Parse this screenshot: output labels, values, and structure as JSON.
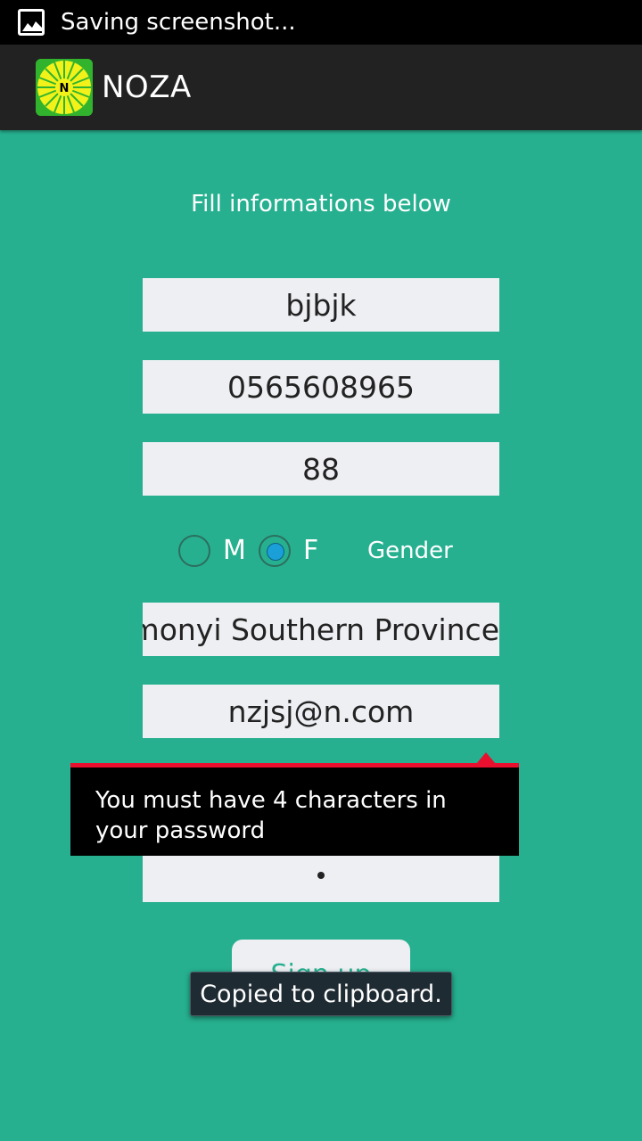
{
  "status_bar": {
    "notification_icon": "image-icon",
    "text": "Saving screenshot..."
  },
  "action_bar": {
    "logo_icon": "noza-logo",
    "logo_letter": "N",
    "title": "NOZA"
  },
  "form": {
    "instruction": "Fill informations below",
    "name_value": "bjbjk",
    "phone_value": "0565608965",
    "age_value": "88",
    "gender": {
      "option_m": "M",
      "option_f": "F",
      "label": "Gender",
      "selected": "F"
    },
    "address_value": "monyi Southern Province",
    "email_value": "nzjsj@n.com",
    "password_masked": "•",
    "signup_label": "Sign up"
  },
  "error_popup": {
    "message": "You must have 4 characters in your password"
  },
  "toast": {
    "message": "Copied to clipboard."
  },
  "colors": {
    "background": "#26B08F",
    "field_background": "#EEEFF3",
    "error_accent": "#E8102E",
    "radio_checked": "#1A9FD9"
  }
}
